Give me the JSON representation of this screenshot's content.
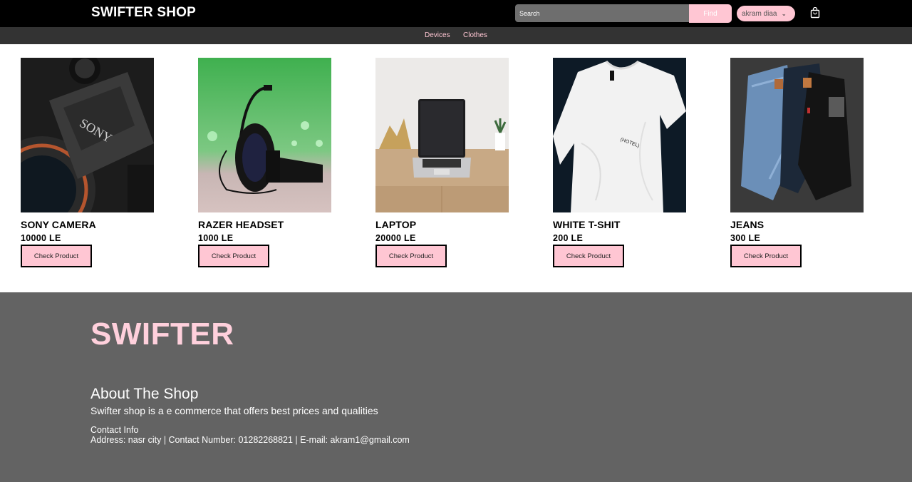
{
  "header": {
    "brand": "SWIFTER SHOP",
    "search_placeholder": "Search",
    "find_label": "Find",
    "user_name": "akram diaa",
    "user_chevron_icon": "chevron-down-icon",
    "cart_icon": "shopping-bag-icon"
  },
  "nav": {
    "categories": [
      "Devices",
      "Clothes"
    ]
  },
  "products": [
    {
      "name": "SONY CAMERA",
      "price": "10000 LE",
      "button": "Check Product",
      "image": "camera-photo"
    },
    {
      "name": "RAZER HEADSET",
      "price": "1000 LE",
      "button": "Check Product",
      "image": "headset-photo"
    },
    {
      "name": "LAPTOP",
      "price": "20000 LE",
      "button": "Check Product",
      "image": "laptop-photo"
    },
    {
      "name": "WHITE T-SHIT",
      "price": "200 LE",
      "button": "Check Product",
      "image": "tshirt-photo"
    },
    {
      "name": "JEANS",
      "price": "300 LE",
      "button": "Check Product",
      "image": "jeans-photo"
    }
  ],
  "footer": {
    "brand": "SWIFTER",
    "about_title": "About The Shop",
    "about_text": "Swifter shop is a e commerce that offers best prices and qualities",
    "contact_title": "Contact Info",
    "contact_details": "Address: nasr city | Contact Number: 01282268821 | E-mail: akram1@gmail.com"
  },
  "colors": {
    "accent_pink": "#ffc6d3",
    "header_bg": "#000000",
    "nav_bg": "#333333",
    "footer_bg": "#636363"
  }
}
